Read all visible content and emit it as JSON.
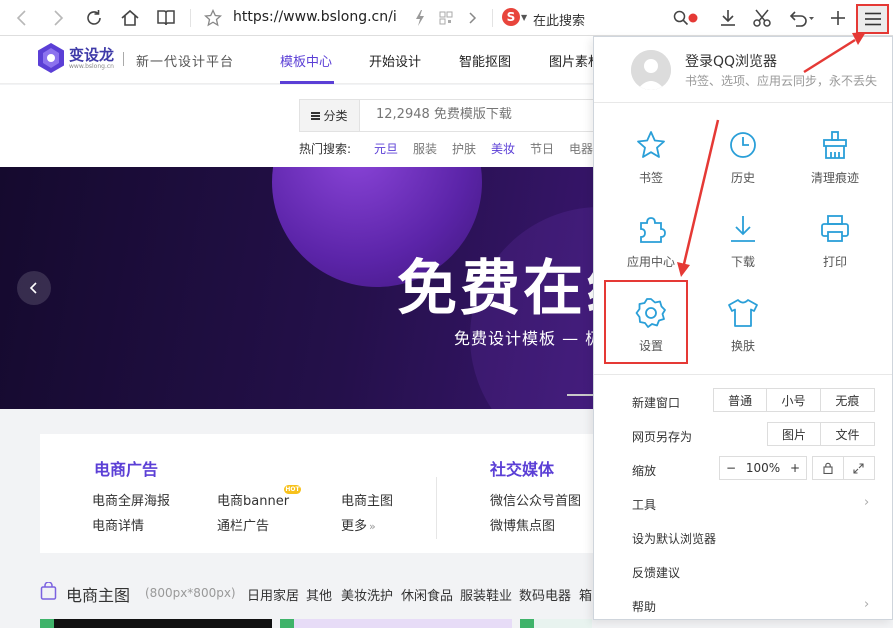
{
  "browser": {
    "url": "https://www.bslong.cn/ind",
    "search_placeholder": "在此搜索",
    "search_engine_letter": "S"
  },
  "site": {
    "logo_name": "变设龙",
    "logo_url": "www.bslong.cn",
    "slogan": "新一代设计平台",
    "nav": [
      "模板中心",
      "开始设计",
      "智能抠图",
      "图片素材"
    ],
    "search": {
      "category_label": "分类",
      "placeholder": "12,2948 免费模版下载"
    },
    "hot_label": "热门搜索:",
    "hot_tags": [
      "元旦",
      "服装",
      "护肤",
      "美妆",
      "节日",
      "电器"
    ]
  },
  "banner": {
    "title": "免费在线",
    "subtitle": "免费设计模板 — 极"
  },
  "categories": {
    "left": {
      "heading": "电商广告",
      "links": [
        "电商全屏海报",
        "电商banner",
        "电商主图",
        "电商详情",
        "通栏广告",
        "更多"
      ],
      "badge": "HOT"
    },
    "right": {
      "heading": "社交媒体",
      "links": [
        "微信公众号首图",
        "微博焦点图"
      ]
    }
  },
  "product_section": {
    "title": "电商主图",
    "size": "(800px*800px)",
    "tabs": [
      "日用家居",
      "其他",
      "美妆洗护",
      "休闲食品",
      "服装鞋业",
      "数码电器",
      "箱"
    ]
  },
  "menu_panel": {
    "login_title": "登录QQ浏览器",
    "login_subtitle": "书签、选项、应用云同步，永不丢失",
    "grid": [
      {
        "label": "书签",
        "icon": "star-icon"
      },
      {
        "label": "历史",
        "icon": "clock-icon"
      },
      {
        "label": "清理痕迹",
        "icon": "broom-icon"
      },
      {
        "label": "应用中心",
        "icon": "puzzle-icon"
      },
      {
        "label": "下载",
        "icon": "download-icon"
      },
      {
        "label": "打印",
        "icon": "printer-icon"
      },
      {
        "label": "设置",
        "icon": "gear-icon"
      },
      {
        "label": "换肤",
        "icon": "tshirt-icon"
      }
    ],
    "rows": {
      "new_window": {
        "label": "新建窗口",
        "options": [
          "普通",
          "小号",
          "无痕"
        ]
      },
      "save_as": {
        "label": "网页另存为",
        "options": [
          "图片",
          "文件"
        ]
      },
      "zoom": {
        "label": "缩放",
        "minus": "−",
        "value": "100%",
        "plus": "+"
      },
      "tools": {
        "label": "工具"
      },
      "default_browser": {
        "label": "设为默认浏览器"
      },
      "feedback": {
        "label": "反馈建议"
      },
      "help": {
        "label": "帮助"
      }
    }
  },
  "colors": {
    "accent": "#5b3fd6",
    "menu_icon": "#2a9fd8",
    "annotation_red": "#e53935"
  }
}
